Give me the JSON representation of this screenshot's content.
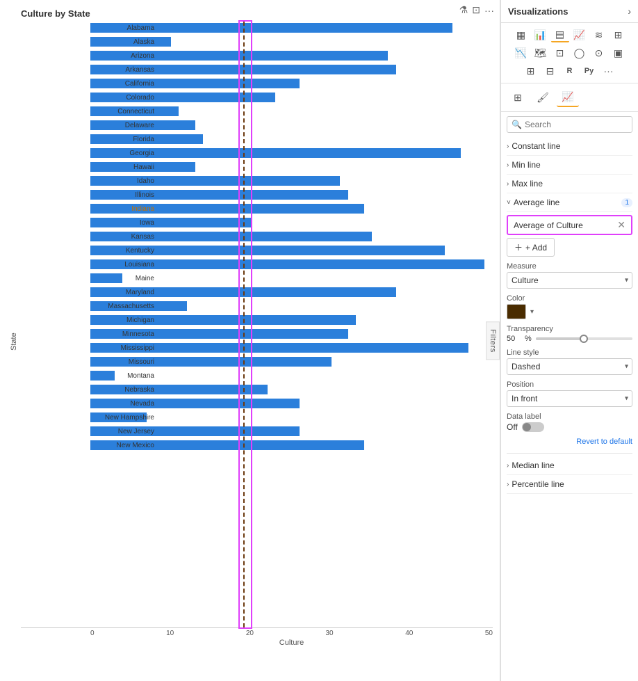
{
  "chart": {
    "title": "Culture by State",
    "x_axis_label": "Culture",
    "y_axis_label": "State",
    "x_ticks": [
      "0",
      "10",
      "20",
      "30",
      "40",
      "50"
    ],
    "average_line_position_pct": 47.2,
    "bars": [
      {
        "label": "Alabama",
        "value": 45,
        "highlighted": false
      },
      {
        "label": "Alaska",
        "value": 10,
        "highlighted": false
      },
      {
        "label": "Arizona",
        "value": 37,
        "highlighted": false
      },
      {
        "label": "Arkansas",
        "value": 38,
        "highlighted": false
      },
      {
        "label": "California",
        "value": 26,
        "highlighted": false
      },
      {
        "label": "Colorado",
        "value": 23,
        "highlighted": false
      },
      {
        "label": "Connecticut",
        "value": 11,
        "highlighted": false
      },
      {
        "label": "Delaware",
        "value": 13,
        "highlighted": false
      },
      {
        "label": "Florida",
        "value": 14,
        "highlighted": false
      },
      {
        "label": "Georgia",
        "value": 46,
        "highlighted": false
      },
      {
        "label": "Hawaii",
        "value": 13,
        "highlighted": false
      },
      {
        "label": "Idaho",
        "value": 31,
        "highlighted": false
      },
      {
        "label": "Illinois",
        "value": 32,
        "highlighted": false
      },
      {
        "label": "Indiana",
        "value": 34,
        "highlighted": true
      },
      {
        "label": "Iowa",
        "value": 20,
        "highlighted": false
      },
      {
        "label": "Kansas",
        "value": 35,
        "highlighted": false
      },
      {
        "label": "Kentucky",
        "value": 44,
        "highlighted": false
      },
      {
        "label": "Louisiana",
        "value": 49,
        "highlighted": false
      },
      {
        "label": "Maine",
        "value": 4,
        "highlighted": false
      },
      {
        "label": "Maryland",
        "value": 38,
        "highlighted": false
      },
      {
        "label": "Massachusetts",
        "value": 12,
        "highlighted": false
      },
      {
        "label": "Michigan",
        "value": 33,
        "highlighted": false
      },
      {
        "label": "Minnesota",
        "value": 32,
        "highlighted": false
      },
      {
        "label": "Mississippi",
        "value": 47,
        "highlighted": false
      },
      {
        "label": "Missouri",
        "value": 30,
        "highlighted": false
      },
      {
        "label": "Montana",
        "value": 3,
        "highlighted": false
      },
      {
        "label": "Nebraska",
        "value": 22,
        "highlighted": false
      },
      {
        "label": "Nevada",
        "value": 26,
        "highlighted": false
      },
      {
        "label": "New Hampshire",
        "value": 7,
        "highlighted": false
      },
      {
        "label": "New Jersey",
        "value": 26,
        "highlighted": false
      },
      {
        "label": "New Mexico",
        "value": 34,
        "highlighted": false
      }
    ],
    "max_value": 50
  },
  "right_panel": {
    "title": "Visualizations",
    "search_placeholder": "Search",
    "sections": [
      {
        "label": "Constant line",
        "badge": null
      },
      {
        "label": "Min line",
        "badge": null
      },
      {
        "label": "Max line",
        "badge": null
      },
      {
        "label": "Average line",
        "badge": "1"
      },
      {
        "label": "Median line",
        "badge": null
      },
      {
        "label": "Percentile line",
        "badge": null
      }
    ],
    "average_line": {
      "pill_text": "Average of Culture",
      "add_button": "+ Add",
      "measure_label": "Measure",
      "measure_value": "Culture",
      "color_label": "Color",
      "transparency_label": "Transparency",
      "transparency_value": "50",
      "transparency_unit": "%",
      "line_style_label": "Line style",
      "line_style_value": "Dashed",
      "position_label": "Position",
      "position_value": "In front",
      "data_label_label": "Data label",
      "data_label_value": "Off",
      "revert_label": "Revert to default"
    },
    "icons": {
      "rows": [
        [
          "▦",
          "📊",
          "▤",
          "📈",
          "≡≡",
          "⊞"
        ],
        [
          "📉",
          "🗺",
          "●●",
          "🍩",
          "⊙",
          "⊡"
        ],
        [
          "⊞",
          "⊟",
          "R",
          "Py",
          "⊠"
        ]
      ]
    }
  },
  "filters": {
    "label": "Filters"
  }
}
